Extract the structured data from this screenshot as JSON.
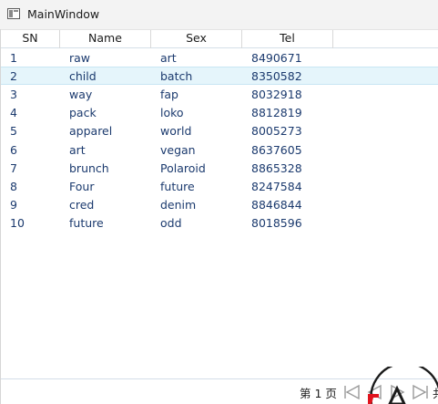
{
  "window": {
    "title": "MainWindow"
  },
  "grid": {
    "columns": [
      "SN",
      "Name",
      "Sex",
      "Tel"
    ],
    "selected_row_index": 1,
    "rows": [
      {
        "sn": "1",
        "name": "raw",
        "sex": "art",
        "tel": "8490671"
      },
      {
        "sn": "2",
        "name": "child",
        "sex": "batch",
        "tel": "8350582"
      },
      {
        "sn": "3",
        "name": "way",
        "sex": "fap",
        "tel": "8032918"
      },
      {
        "sn": "4",
        "name": "pack",
        "sex": "loko",
        "tel": "8812819"
      },
      {
        "sn": "5",
        "name": "apparel",
        "sex": "world",
        "tel": "8005273"
      },
      {
        "sn": "6",
        "name": "art",
        "sex": "vegan",
        "tel": "8637605"
      },
      {
        "sn": "7",
        "name": "brunch",
        "sex": "Polaroid",
        "tel": "8865328"
      },
      {
        "sn": "8",
        "name": "Four",
        "sex": "future",
        "tel": "8247584"
      },
      {
        "sn": "9",
        "name": "cred",
        "sex": "denim",
        "tel": "8846844"
      },
      {
        "sn": "10",
        "name": "future",
        "sex": "odd",
        "tel": "8018596"
      }
    ]
  },
  "pager": {
    "page_label": "第 1 页",
    "total_label": "共",
    "buttons": [
      "first-page-icon",
      "previous-page-icon",
      "next-page-icon",
      "last-page-icon"
    ]
  },
  "colors": {
    "selected_row": "#e5f5fb",
    "cell_text": "#1b3a6e",
    "pager_icon": "#9a9a9a",
    "watermark_red": "#e0141e"
  }
}
